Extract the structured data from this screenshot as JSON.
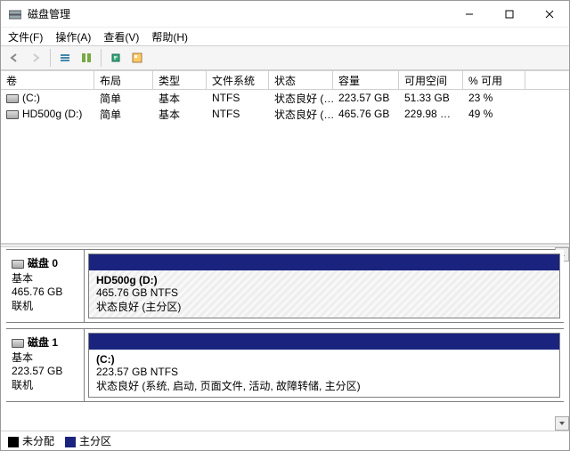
{
  "window": {
    "title": "磁盘管理"
  },
  "menu": {
    "file": "文件(F)",
    "action": "操作(A)",
    "view": "查看(V)",
    "help": "帮助(H)"
  },
  "columns": {
    "volume": "卷",
    "layout": "布局",
    "type": "类型",
    "fs": "文件系统",
    "status": "状态",
    "capacity": "容量",
    "free": "可用空间",
    "pctfree": "% 可用"
  },
  "volumes": [
    {
      "name": "(C:)",
      "layout": "简单",
      "type": "基本",
      "fs": "NTFS",
      "status": "状态良好 (…",
      "capacity": "223.57 GB",
      "free": "51.33 GB",
      "pctfree": "23 %"
    },
    {
      "name": "HD500g (D:)",
      "layout": "简单",
      "type": "基本",
      "fs": "NTFS",
      "status": "状态良好 (…",
      "capacity": "465.76 GB",
      "free": "229.98 …",
      "pctfree": "49 %"
    }
  ],
  "disks": [
    {
      "label": "磁盘 0",
      "type": "基本",
      "size": "465.76 GB",
      "state": "联机",
      "part": {
        "name": "HD500g  (D:)",
        "line2": "465.76 GB NTFS",
        "line3": "状态良好 (主分区)"
      },
      "hatched": true
    },
    {
      "label": "磁盘 1",
      "type": "基本",
      "size": "223.57 GB",
      "state": "联机",
      "part": {
        "name": "(C:)",
        "line2": "223.57 GB NTFS",
        "line3": "状态良好 (系统, 启动, 页面文件, 活动, 故障转储, 主分区)"
      },
      "hatched": false
    }
  ],
  "legend": {
    "unalloc": "未分配",
    "primary": "主分区"
  }
}
